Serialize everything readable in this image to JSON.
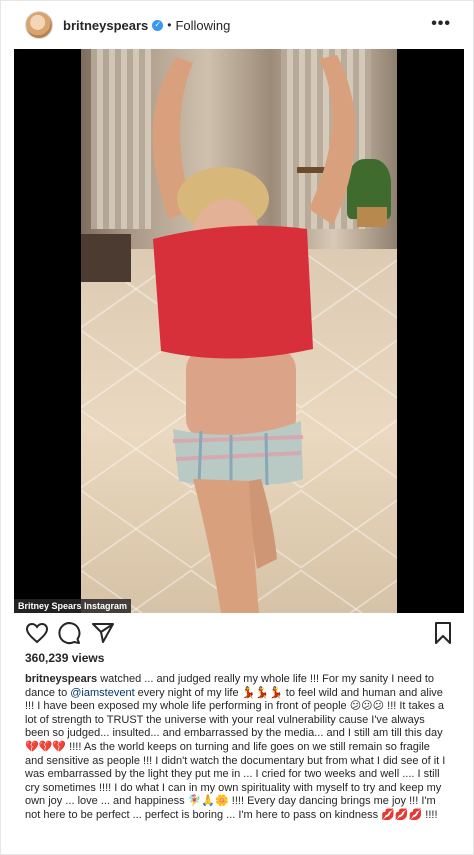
{
  "header": {
    "username": "britneyspears",
    "separator": "•",
    "follow_state": "Following",
    "more_glyph": "•••"
  },
  "media": {
    "credit": "Britney Spears Instagram"
  },
  "colors": {
    "text": "#262626",
    "verified": "#3897f0",
    "mention": "#003569",
    "top_red": "#d8303a"
  },
  "actions": {
    "icons": [
      "heart-icon",
      "comment-icon",
      "share-icon",
      "bookmark-icon"
    ]
  },
  "stats": {
    "views": "360,239 views"
  },
  "caption": {
    "username": "britneyspears",
    "before_mention": " watched ... and judged really my whole life !!! For my sanity I need to dance to ",
    "mention": "@iamstevent",
    "after_mention": " every night of my life 💃💃💃 to feel wild and human and alive !!! I have been exposed my whole life performing in front of people 😕😕😕 !!! It takes a lot of strength to TRUST the universe with your real vulnerability cause I've always been so judged... insulted... and embarrassed by the media... and I still am till this day 💔💔💔 !!!! As the world keeps on turning and life goes on we still remain so fragile and sensitive as people !!! I didn't watch the documentary but from what I did see of it I was embarrassed by the light they put me in ... I cried for two weeks and well .... I still cry sometimes !!!! I do what I can in my own spirituality with myself to try and keep my own joy ... love ... and happiness 🧚‍♀️🙏🌼 !!!! Every day dancing brings me joy !!! I'm not here to be perfect ... perfect is boring ... I'm here to pass on kindness 💋💋💋 !!!!"
  }
}
